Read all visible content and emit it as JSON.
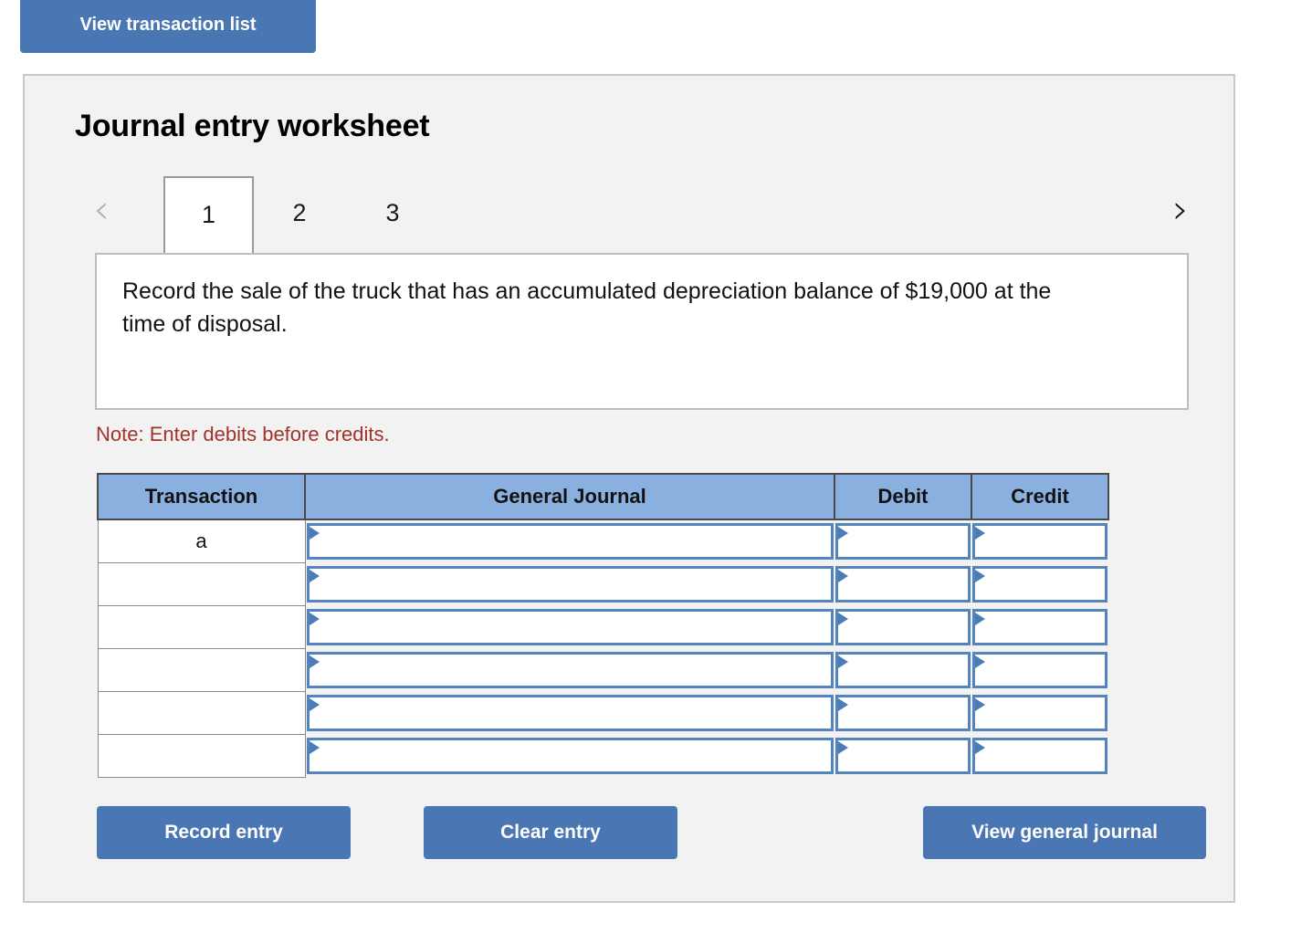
{
  "top_actions": {
    "view_transaction_list": "View transaction list"
  },
  "worksheet": {
    "title": "Journal entry worksheet",
    "tabs": [
      {
        "label": "1",
        "active": true
      },
      {
        "label": "2",
        "active": false
      },
      {
        "label": "3",
        "active": false
      }
    ],
    "nav": {
      "prev_icon": "chevron-left-icon",
      "next_icon": "chevron-right-icon",
      "prev_glyph": "‹",
      "next_glyph": "›",
      "prev_enabled": false,
      "next_enabled": true
    },
    "description": "Record the sale of the truck that has an accumulated depreciation balance of $19,000 at the time of disposal.",
    "note": "Note: Enter debits before credits."
  },
  "table": {
    "columns": [
      "Transaction",
      "General Journal",
      "Debit",
      "Credit"
    ],
    "rows": [
      {
        "transaction": "a",
        "general_journal": "",
        "debit": "",
        "credit": ""
      },
      {
        "transaction": "",
        "general_journal": "",
        "debit": "",
        "credit": ""
      },
      {
        "transaction": "",
        "general_journal": "",
        "debit": "",
        "credit": ""
      },
      {
        "transaction": "",
        "general_journal": "",
        "debit": "",
        "credit": ""
      },
      {
        "transaction": "",
        "general_journal": "",
        "debit": "",
        "credit": ""
      },
      {
        "transaction": "",
        "general_journal": "",
        "debit": "",
        "credit": ""
      }
    ]
  },
  "bottom_actions": {
    "record_entry": "Record entry",
    "clear_entry": "Clear entry",
    "view_general_journal": "View general journal"
  },
  "colors": {
    "button_blue": "#4a77b4",
    "header_blue": "#8ab0e0",
    "cell_border_blue": "#5584bd",
    "note_red": "#a3322b",
    "panel_gray": "#f2f2f2",
    "panel_border": "#c8c8c8"
  }
}
